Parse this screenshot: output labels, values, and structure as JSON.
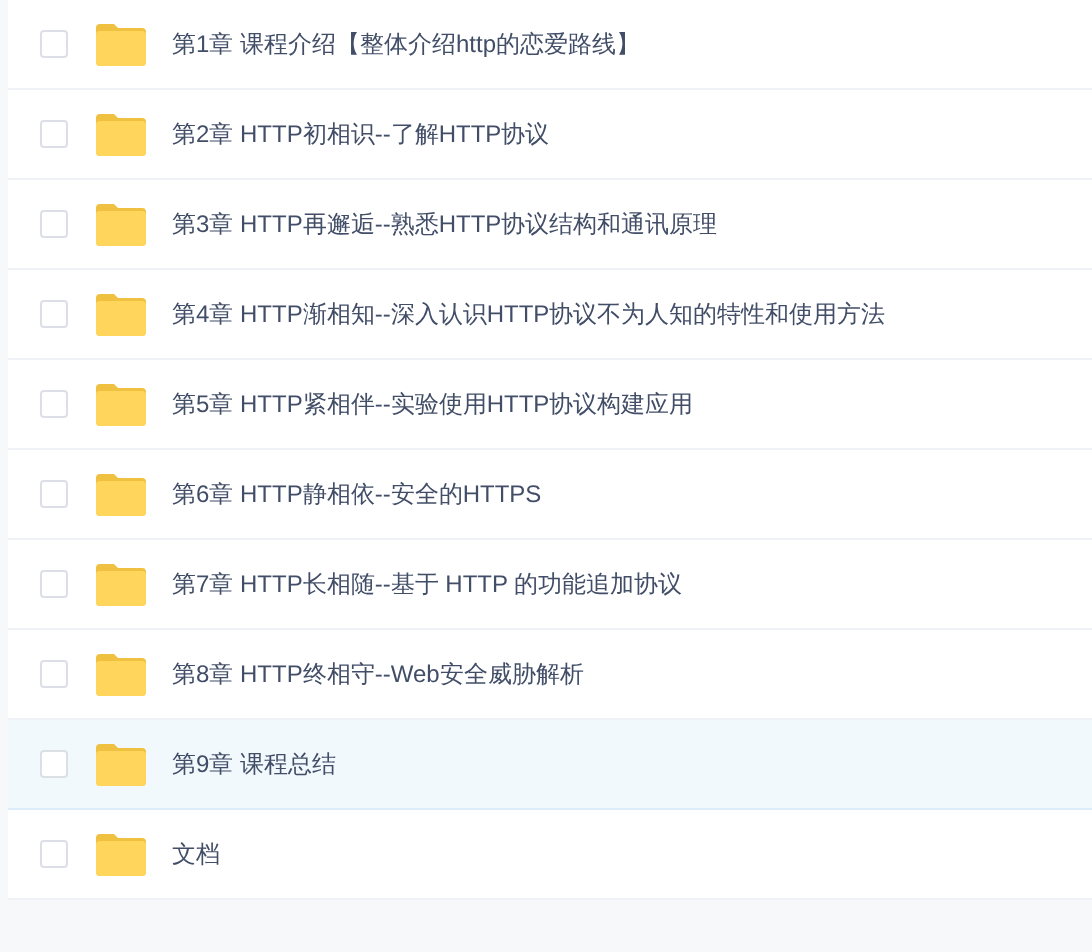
{
  "folders": [
    {
      "name": "第1章 课程介绍【整体介绍http的恋爱路线】",
      "checked": false,
      "highlighted": false
    },
    {
      "name": "第2章 HTTP初相识--了解HTTP协议",
      "checked": false,
      "highlighted": false
    },
    {
      "name": "第3章 HTTP再邂逅--熟悉HTTP协议结构和通讯原理",
      "checked": false,
      "highlighted": false
    },
    {
      "name": "第4章 HTTP渐相知--深入认识HTTP协议不为人知的特性和使用方法",
      "checked": false,
      "highlighted": false
    },
    {
      "name": "第5章 HTTP紧相伴--实验使用HTTP协议构建应用",
      "checked": false,
      "highlighted": false
    },
    {
      "name": "第6章 HTTP静相依--安全的HTTPS",
      "checked": false,
      "highlighted": false
    },
    {
      "name": "第7章 HTTP长相随--基于 HTTP 的功能追加协议",
      "checked": false,
      "highlighted": false
    },
    {
      "name": "第8章 HTTP终相守--Web安全威胁解析",
      "checked": false,
      "highlighted": false
    },
    {
      "name": "第9章 课程总结",
      "checked": false,
      "highlighted": true
    },
    {
      "name": "文档",
      "checked": false,
      "highlighted": false
    }
  ]
}
